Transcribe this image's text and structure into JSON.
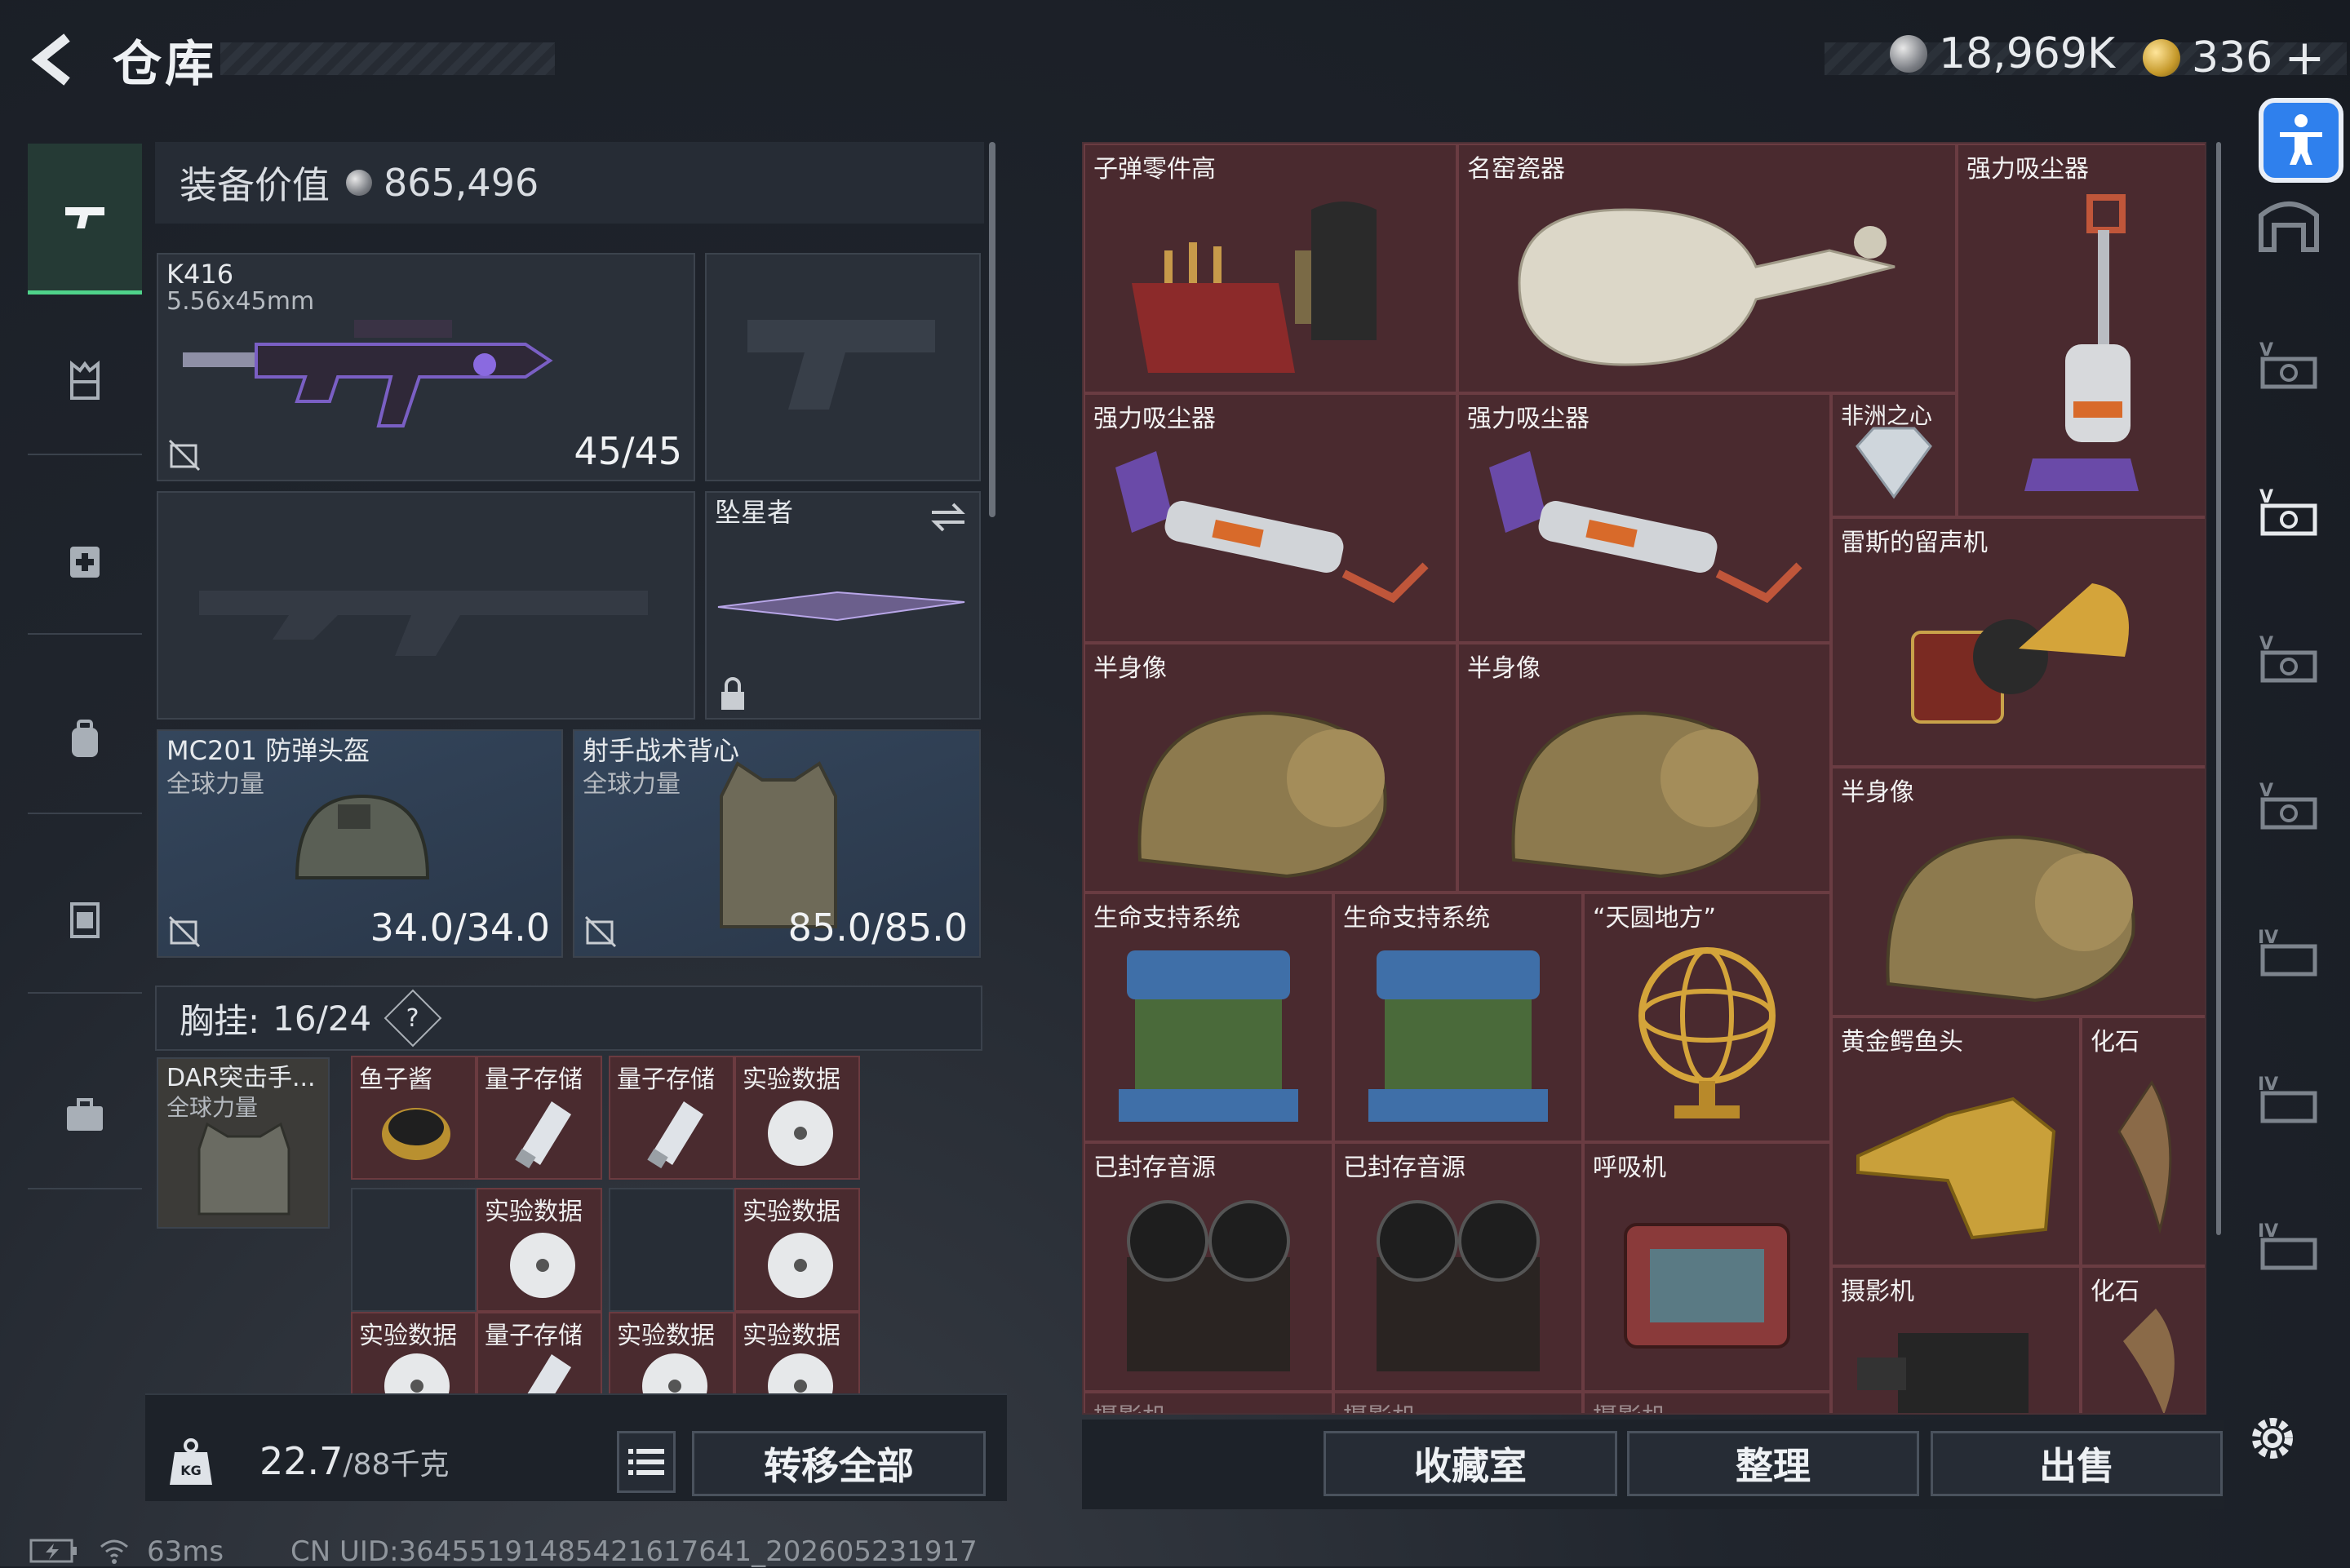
{
  "header": {
    "title": "仓库",
    "silver_amount": "18,969K",
    "gold_amount": "336",
    "add_label": "+"
  },
  "equipment": {
    "label": "装备价值",
    "value": "865,496"
  },
  "slots": {
    "primary": {
      "name": "K416",
      "caliber": "5.56x45mm",
      "ammo": "45/45"
    },
    "melee": {
      "name": "坠星者"
    },
    "helmet": {
      "name": "MC201 防弹头盔",
      "faction": "全球力量",
      "durability": "34.0/34.0"
    },
    "armor": {
      "name": "射手战术背心",
      "faction": "全球力量",
      "durability": "85.0/85.0"
    },
    "rig": {
      "name": "DAR突击手...",
      "faction": "全球力量"
    }
  },
  "rig_bar": {
    "label": "胸挂:",
    "capacity": "16/24",
    "help": "?"
  },
  "rig_cells": [
    {
      "name": "鱼子酱"
    },
    {
      "name": "量子存储"
    },
    {
      "name": "量子存储"
    },
    {
      "name": "实验数据"
    },
    {
      "name": "实验数据"
    },
    {
      "name": "实验数据"
    },
    {
      "name": "实验数据"
    },
    {
      "name": "量子存储"
    },
    {
      "name": "实验数据"
    },
    {
      "name": "实验数据"
    }
  ],
  "footer_left": {
    "weight_value": "22.7",
    "weight_max": "/88千克",
    "transfer_all": "转移全部"
  },
  "storage_items": [
    {
      "name": "子弹零件高"
    },
    {
      "name": "名窑瓷器"
    },
    {
      "name": "强力吸尘器"
    },
    {
      "name": "强力吸尘器"
    },
    {
      "name": "强力吸尘器"
    },
    {
      "name": "非洲之心"
    },
    {
      "name": "雷斯的留声机"
    },
    {
      "name": "半身像"
    },
    {
      "name": "半身像"
    },
    {
      "name": "半身像"
    },
    {
      "name": "生命支持系统"
    },
    {
      "name": "生命支持系统"
    },
    {
      "name": "“天圆地方”"
    },
    {
      "name": "黄金鳄鱼头"
    },
    {
      "name": "化石"
    },
    {
      "name": "已封存音源"
    },
    {
      "name": "已封存音源"
    },
    {
      "name": "呼吸机"
    },
    {
      "name": "摄影机"
    },
    {
      "name": "化石"
    },
    {
      "name": "摄影机"
    },
    {
      "name": "摄影机"
    },
    {
      "name": "摄影机"
    }
  ],
  "storage_buttons": {
    "collection": "收藏室",
    "sort": "整理",
    "sell": "出售"
  },
  "status_bar": {
    "ping": "63ms",
    "uid": "CN UID:36455191485421617641_202605231917"
  },
  "colors": {
    "accent_green": "#4fd38a",
    "item_bg": "#4a2a2f",
    "access_blue": "#2f80ed"
  }
}
